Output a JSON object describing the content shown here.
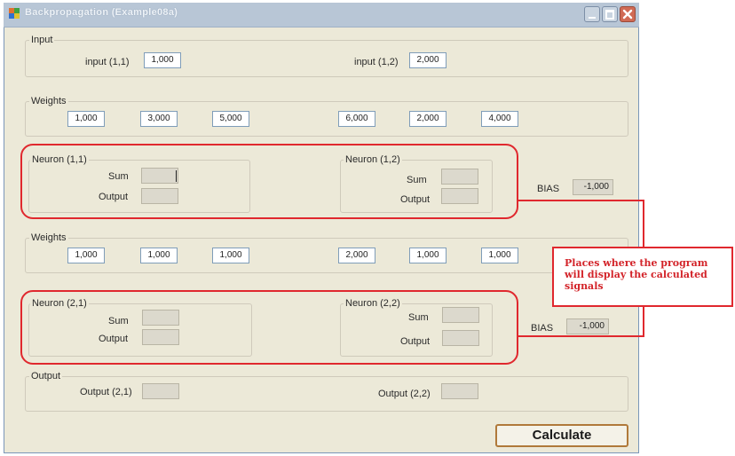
{
  "window": {
    "title": "Backpropagation (Example08a)",
    "accent_color": "#e0282e"
  },
  "input_group": {
    "label": "Input",
    "input_1_1": {
      "label": "input (1,1)",
      "value": "1,000"
    },
    "input_1_2": {
      "label": "input (1,2)",
      "value": "2,000"
    }
  },
  "weights1": {
    "label": "Weights",
    "values": [
      "1,000",
      "3,000",
      "5,000",
      "6,000",
      "2,000",
      "4,000"
    ]
  },
  "neuron_1_1": {
    "label": "Neuron (1,1)",
    "sum_label": "Sum",
    "output_label": "Output"
  },
  "neuron_1_2": {
    "label": "Neuron (1,2)",
    "sum_label": "Sum",
    "output_label": "Output"
  },
  "bias1": {
    "label": "BIAS",
    "value": "-1,000"
  },
  "weights2": {
    "label": "Weights",
    "values": [
      "1,000",
      "1,000",
      "1,000",
      "2,000",
      "1,000",
      "1,000"
    ]
  },
  "neuron_2_1": {
    "label": "Neuron (2,1)",
    "sum_label": "Sum",
    "output_label": "Output"
  },
  "neuron_2_2": {
    "label": "Neuron (2,2)",
    "sum_label": "Sum",
    "output_label": "Output"
  },
  "bias2": {
    "label": "BIAS",
    "value": "-1,000"
  },
  "output_group": {
    "label": "Output",
    "output_2_1_label": "Output (2,1)",
    "output_2_2_label": "Output (2,2)"
  },
  "calculate_label": "Calculate",
  "annotation": {
    "text": "Places where the program will display the calculated signals"
  }
}
